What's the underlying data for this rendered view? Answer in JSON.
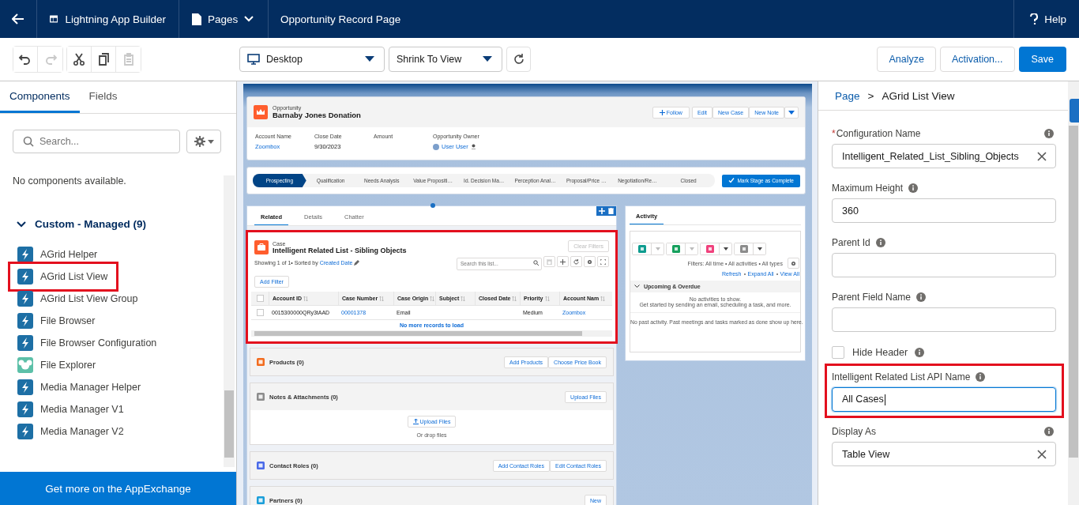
{
  "top_bar": {
    "app_title": "Lightning App Builder",
    "pages_menu": "Pages",
    "page_name": "Opportunity Record Page",
    "help": "Help"
  },
  "toolbar": {
    "edit_tools": [
      {
        "kind": "undo",
        "disabled": false
      },
      {
        "kind": "redo",
        "disabled": true
      },
      {
        "kind": "cut",
        "disabled": false
      },
      {
        "kind": "copy",
        "disabled": false
      },
      {
        "kind": "paste",
        "disabled": true
      }
    ],
    "device": "Desktop",
    "zoom": "Shrink To View",
    "buttons": [
      "Analyze",
      "Activation..."
    ],
    "save": "Save"
  },
  "left_panel": {
    "tabs": [
      {
        "label": "Components",
        "selected": true
      },
      {
        "label": "Fields",
        "selected": false
      }
    ],
    "search": {
      "placeholder": "Search..."
    },
    "empty_message": "No components available.",
    "section": {
      "title": "Custom - Managed (9)",
      "expanded": true,
      "items": [
        {
          "label": "AGrid Helper",
          "kind": "lightning",
          "highlighted": false
        },
        {
          "label": "AGrid List View",
          "kind": "lightning",
          "highlighted": true
        },
        {
          "label": "AGrid List View Group",
          "kind": "lightning",
          "highlighted": false
        },
        {
          "label": "File Browser",
          "kind": "lightning",
          "highlighted": false
        },
        {
          "label": "File Browser Configuration",
          "kind": "lightning",
          "highlighted": false
        },
        {
          "label": "File Explorer",
          "kind": "animal",
          "highlighted": false
        },
        {
          "label": "Media Manager Helper",
          "kind": "lightning",
          "highlighted": false
        },
        {
          "label": "Media Manager V1",
          "kind": "lightning",
          "highlighted": false
        },
        {
          "label": "Media Manager V2",
          "kind": "lightning",
          "highlighted": false
        }
      ]
    },
    "footer": "Get more on the AppExchange"
  },
  "canvas": {
    "header": {
      "object": "Opportunity",
      "title": "Barnaby Jones Donation",
      "actions": [
        "Follow",
        "Edit",
        "New Case",
        "New Note"
      ],
      "fields": [
        {
          "label": "Account Name",
          "value": "Zoombox",
          "kind": "link"
        },
        {
          "label": "Close Date",
          "value": "9/30/2023",
          "kind": "text"
        },
        {
          "label": "Amount"
        },
        {
          "label": "Opportunity Owner",
          "value": "User User",
          "kind": "user"
        }
      ]
    },
    "path": {
      "stages": [
        {
          "label": "Prospecting",
          "selected": true
        },
        {
          "label": "Qualification",
          "selected": false
        },
        {
          "label": "Needs Analysis",
          "selected": false
        },
        {
          "label": "Value Propositi…",
          "selected": false
        },
        {
          "label": "Id. Decision Ma…",
          "selected": false
        },
        {
          "label": "Perception Anal…",
          "selected": false
        },
        {
          "label": "Proposal/Price …",
          "selected": false
        },
        {
          "label": "Negotiation/Re…",
          "selected": false
        },
        {
          "label": "Closed",
          "selected": false
        }
      ],
      "button": "Mark Stage as Complete"
    },
    "tabs": [
      {
        "label": "Related",
        "selected": true
      },
      {
        "label": "Details",
        "selected": false
      },
      {
        "label": "Chatter",
        "selected": false
      }
    ],
    "related_list": {
      "highlighted": true,
      "object": "Case",
      "title": "Intelligent Related List - Sibling Objects",
      "info": "Showing 1 of 1• Sorted by",
      "sort_field": "Created Date",
      "clear_filters": "Clear Filters",
      "search": {
        "placeholder": "Search this list..."
      },
      "add_filter": "Add Filter",
      "columns": [
        "Account ID",
        "Case Number",
        "Case Origin",
        "Subject",
        "Closed Date",
        "Priority",
        "Account Nam"
      ],
      "rows": [
        {
          "checked": false,
          "cells": [
            {
              "text": "0015300000QRy3tAAD",
              "link": false
            },
            {
              "text": "00001378",
              "link": true
            },
            {
              "text": "Email",
              "link": false
            },
            null,
            null,
            {
              "text": "Medium",
              "link": false
            },
            {
              "text": "Zoombox",
              "link": true
            }
          ]
        }
      ],
      "footer": "No more records to load"
    },
    "cards": [
      {
        "title": "Products (0)",
        "color": "#f26c1f",
        "actions": [
          "Add Products",
          "Choose Price Book"
        ]
      },
      {
        "title": "Notes & Attachments (0)",
        "color": "#8c8c8c",
        "actions": [
          "Upload Files"
        ],
        "upload": {
          "button": "Upload Files",
          "hint": "Or drop files"
        }
      },
      {
        "title": "Contact Roles (0)",
        "color": "#4a6ae8",
        "actions": [
          "Add Contact Roles",
          "Edit Contact Roles"
        ]
      },
      {
        "title": "Partners (0)",
        "color": "#1a9ed9",
        "actions": [
          "New"
        ]
      }
    ],
    "activity": {
      "tab": "Activity",
      "composers": [
        {
          "color": "#0e9c8f",
          "enabled": false
        },
        {
          "color": "#16a05d",
          "enabled": false
        },
        {
          "color": "#f0427d",
          "enabled": true
        },
        {
          "color": "#8c8c8c",
          "enabled": true
        }
      ],
      "filters": "Filters: All time • All activities • All types",
      "links": [
        "Refresh",
        "Expand All",
        "View All"
      ],
      "section": {
        "title": "Upcoming & Overdue",
        "expanded": true,
        "empty": "No activities to show.",
        "hint": "Get started by sending an email, scheduling a task, and more."
      },
      "past": "No past activity. Past meetings and tasks marked as done show up here."
    }
  },
  "right_panel": {
    "breadcrumb": {
      "items": [
        "Page",
        "AGrid List View"
      ],
      "separator": ">"
    },
    "properties": [
      {
        "kind": "text",
        "label": "Configuration Name",
        "required_mark": "*",
        "value": "Intelligent_Related_List_Sibling_Objects",
        "clearable": true,
        "focused": false
      },
      {
        "kind": "text",
        "label": "Maximum Height",
        "value": "360",
        "clearable": false,
        "focused": false
      },
      {
        "kind": "text",
        "label": "Parent Id",
        "clearable": false,
        "focused": false
      },
      {
        "kind": "text",
        "label": "Parent Field Name",
        "clearable": false,
        "focused": false
      },
      {
        "kind": "checkbox",
        "label": "Hide Header",
        "checked": false
      },
      {
        "kind": "text",
        "label": "Intelligent Related List API Name",
        "value": "All Cases",
        "clearable": false,
        "focused": true,
        "highlighted": true
      },
      {
        "kind": "text",
        "label": "Display As",
        "value": "Table View",
        "clearable": true,
        "focused": false
      }
    ]
  }
}
